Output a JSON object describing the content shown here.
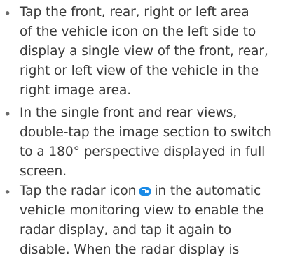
{
  "bullets": [
    {
      "lines": [
        "Tap the front, rear, right or left area",
        "of the vehicle icon on the left side to",
        "display a single view of the front, rear,",
        "right or left view of the vehicle in the",
        "right image area."
      ]
    },
    {
      "lines": [
        "In the single front and rear views,",
        "double-tap the image section to switch",
        "to a 180° perspective displayed in full",
        "screen."
      ]
    },
    {
      "line1_before_icon": "Tap the radar icon",
      "line1_after_icon": "in the automatic",
      "radar_icon": "radar-icon",
      "lines": [
        "vehicle monitoring view to enable the",
        "radar display, and tap it again to",
        "disable. When the radar display is"
      ]
    }
  ],
  "colors": {
    "text": "#3a3a3a",
    "bullet": "#6a6a6a",
    "radar_icon": "#1a8ae6"
  }
}
